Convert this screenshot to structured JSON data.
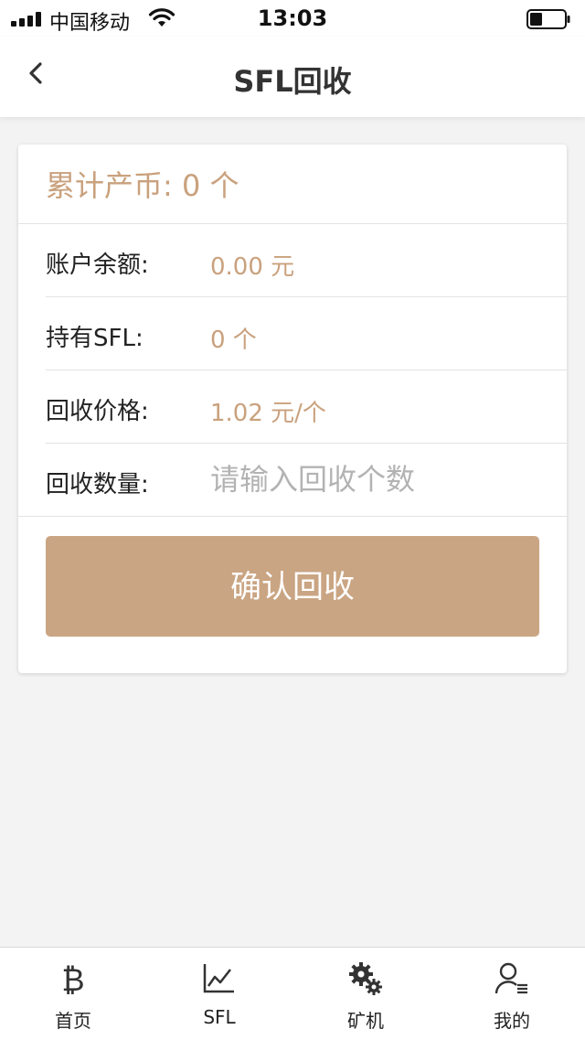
{
  "status_bar": {
    "carrier": "中国移动",
    "time": "13:03"
  },
  "nav": {
    "title": "SFL回收"
  },
  "summary": {
    "text": "累计产币: 0 个"
  },
  "rows": [
    {
      "label": "账户余额:",
      "value": "0.00 元"
    },
    {
      "label": "持有SFL:",
      "value": "0 个"
    },
    {
      "label": "回收价格:",
      "value": "1.02 元/个"
    }
  ],
  "quantity": {
    "label": "回收数量:",
    "placeholder": "请输入回收个数",
    "value": ""
  },
  "confirm_button": {
    "label": "确认回收"
  },
  "tabs": [
    {
      "label": "首页",
      "icon": "bitcoin-icon"
    },
    {
      "label": "SFL",
      "icon": "line-chart-icon"
    },
    {
      "label": "矿机",
      "icon": "gears-icon"
    },
    {
      "label": "我的",
      "icon": "user-icon"
    }
  ],
  "colors": {
    "accent": "#c9a17d",
    "button": "#caa583",
    "background": "#f3f3f3"
  }
}
